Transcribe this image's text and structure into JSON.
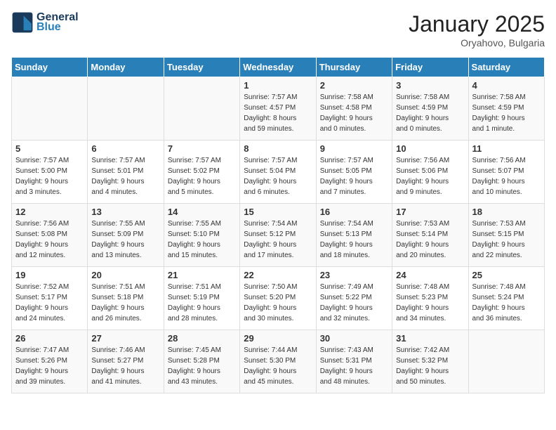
{
  "header": {
    "logo_line1": "General",
    "logo_line2": "Blue",
    "month": "January 2025",
    "location": "Oryahovo, Bulgaria"
  },
  "days_of_week": [
    "Sunday",
    "Monday",
    "Tuesday",
    "Wednesday",
    "Thursday",
    "Friday",
    "Saturday"
  ],
  "weeks": [
    [
      {
        "day": "",
        "info": ""
      },
      {
        "day": "",
        "info": ""
      },
      {
        "day": "",
        "info": ""
      },
      {
        "day": "1",
        "info": "Sunrise: 7:57 AM\nSunset: 4:57 PM\nDaylight: 8 hours\nand 59 minutes."
      },
      {
        "day": "2",
        "info": "Sunrise: 7:58 AM\nSunset: 4:58 PM\nDaylight: 9 hours\nand 0 minutes."
      },
      {
        "day": "3",
        "info": "Sunrise: 7:58 AM\nSunset: 4:59 PM\nDaylight: 9 hours\nand 0 minutes."
      },
      {
        "day": "4",
        "info": "Sunrise: 7:58 AM\nSunset: 4:59 PM\nDaylight: 9 hours\nand 1 minute."
      }
    ],
    [
      {
        "day": "5",
        "info": "Sunrise: 7:57 AM\nSunset: 5:00 PM\nDaylight: 9 hours\nand 3 minutes."
      },
      {
        "day": "6",
        "info": "Sunrise: 7:57 AM\nSunset: 5:01 PM\nDaylight: 9 hours\nand 4 minutes."
      },
      {
        "day": "7",
        "info": "Sunrise: 7:57 AM\nSunset: 5:02 PM\nDaylight: 9 hours\nand 5 minutes."
      },
      {
        "day": "8",
        "info": "Sunrise: 7:57 AM\nSunset: 5:04 PM\nDaylight: 9 hours\nand 6 minutes."
      },
      {
        "day": "9",
        "info": "Sunrise: 7:57 AM\nSunset: 5:05 PM\nDaylight: 9 hours\nand 7 minutes."
      },
      {
        "day": "10",
        "info": "Sunrise: 7:56 AM\nSunset: 5:06 PM\nDaylight: 9 hours\nand 9 minutes."
      },
      {
        "day": "11",
        "info": "Sunrise: 7:56 AM\nSunset: 5:07 PM\nDaylight: 9 hours\nand 10 minutes."
      }
    ],
    [
      {
        "day": "12",
        "info": "Sunrise: 7:56 AM\nSunset: 5:08 PM\nDaylight: 9 hours\nand 12 minutes."
      },
      {
        "day": "13",
        "info": "Sunrise: 7:55 AM\nSunset: 5:09 PM\nDaylight: 9 hours\nand 13 minutes."
      },
      {
        "day": "14",
        "info": "Sunrise: 7:55 AM\nSunset: 5:10 PM\nDaylight: 9 hours\nand 15 minutes."
      },
      {
        "day": "15",
        "info": "Sunrise: 7:54 AM\nSunset: 5:12 PM\nDaylight: 9 hours\nand 17 minutes."
      },
      {
        "day": "16",
        "info": "Sunrise: 7:54 AM\nSunset: 5:13 PM\nDaylight: 9 hours\nand 18 minutes."
      },
      {
        "day": "17",
        "info": "Sunrise: 7:53 AM\nSunset: 5:14 PM\nDaylight: 9 hours\nand 20 minutes."
      },
      {
        "day": "18",
        "info": "Sunrise: 7:53 AM\nSunset: 5:15 PM\nDaylight: 9 hours\nand 22 minutes."
      }
    ],
    [
      {
        "day": "19",
        "info": "Sunrise: 7:52 AM\nSunset: 5:17 PM\nDaylight: 9 hours\nand 24 minutes."
      },
      {
        "day": "20",
        "info": "Sunrise: 7:51 AM\nSunset: 5:18 PM\nDaylight: 9 hours\nand 26 minutes."
      },
      {
        "day": "21",
        "info": "Sunrise: 7:51 AM\nSunset: 5:19 PM\nDaylight: 9 hours\nand 28 minutes."
      },
      {
        "day": "22",
        "info": "Sunrise: 7:50 AM\nSunset: 5:20 PM\nDaylight: 9 hours\nand 30 minutes."
      },
      {
        "day": "23",
        "info": "Sunrise: 7:49 AM\nSunset: 5:22 PM\nDaylight: 9 hours\nand 32 minutes."
      },
      {
        "day": "24",
        "info": "Sunrise: 7:48 AM\nSunset: 5:23 PM\nDaylight: 9 hours\nand 34 minutes."
      },
      {
        "day": "25",
        "info": "Sunrise: 7:48 AM\nSunset: 5:24 PM\nDaylight: 9 hours\nand 36 minutes."
      }
    ],
    [
      {
        "day": "26",
        "info": "Sunrise: 7:47 AM\nSunset: 5:26 PM\nDaylight: 9 hours\nand 39 minutes."
      },
      {
        "day": "27",
        "info": "Sunrise: 7:46 AM\nSunset: 5:27 PM\nDaylight: 9 hours\nand 41 minutes."
      },
      {
        "day": "28",
        "info": "Sunrise: 7:45 AM\nSunset: 5:28 PM\nDaylight: 9 hours\nand 43 minutes."
      },
      {
        "day": "29",
        "info": "Sunrise: 7:44 AM\nSunset: 5:30 PM\nDaylight: 9 hours\nand 45 minutes."
      },
      {
        "day": "30",
        "info": "Sunrise: 7:43 AM\nSunset: 5:31 PM\nDaylight: 9 hours\nand 48 minutes."
      },
      {
        "day": "31",
        "info": "Sunrise: 7:42 AM\nSunset: 5:32 PM\nDaylight: 9 hours\nand 50 minutes."
      },
      {
        "day": "",
        "info": ""
      }
    ]
  ]
}
